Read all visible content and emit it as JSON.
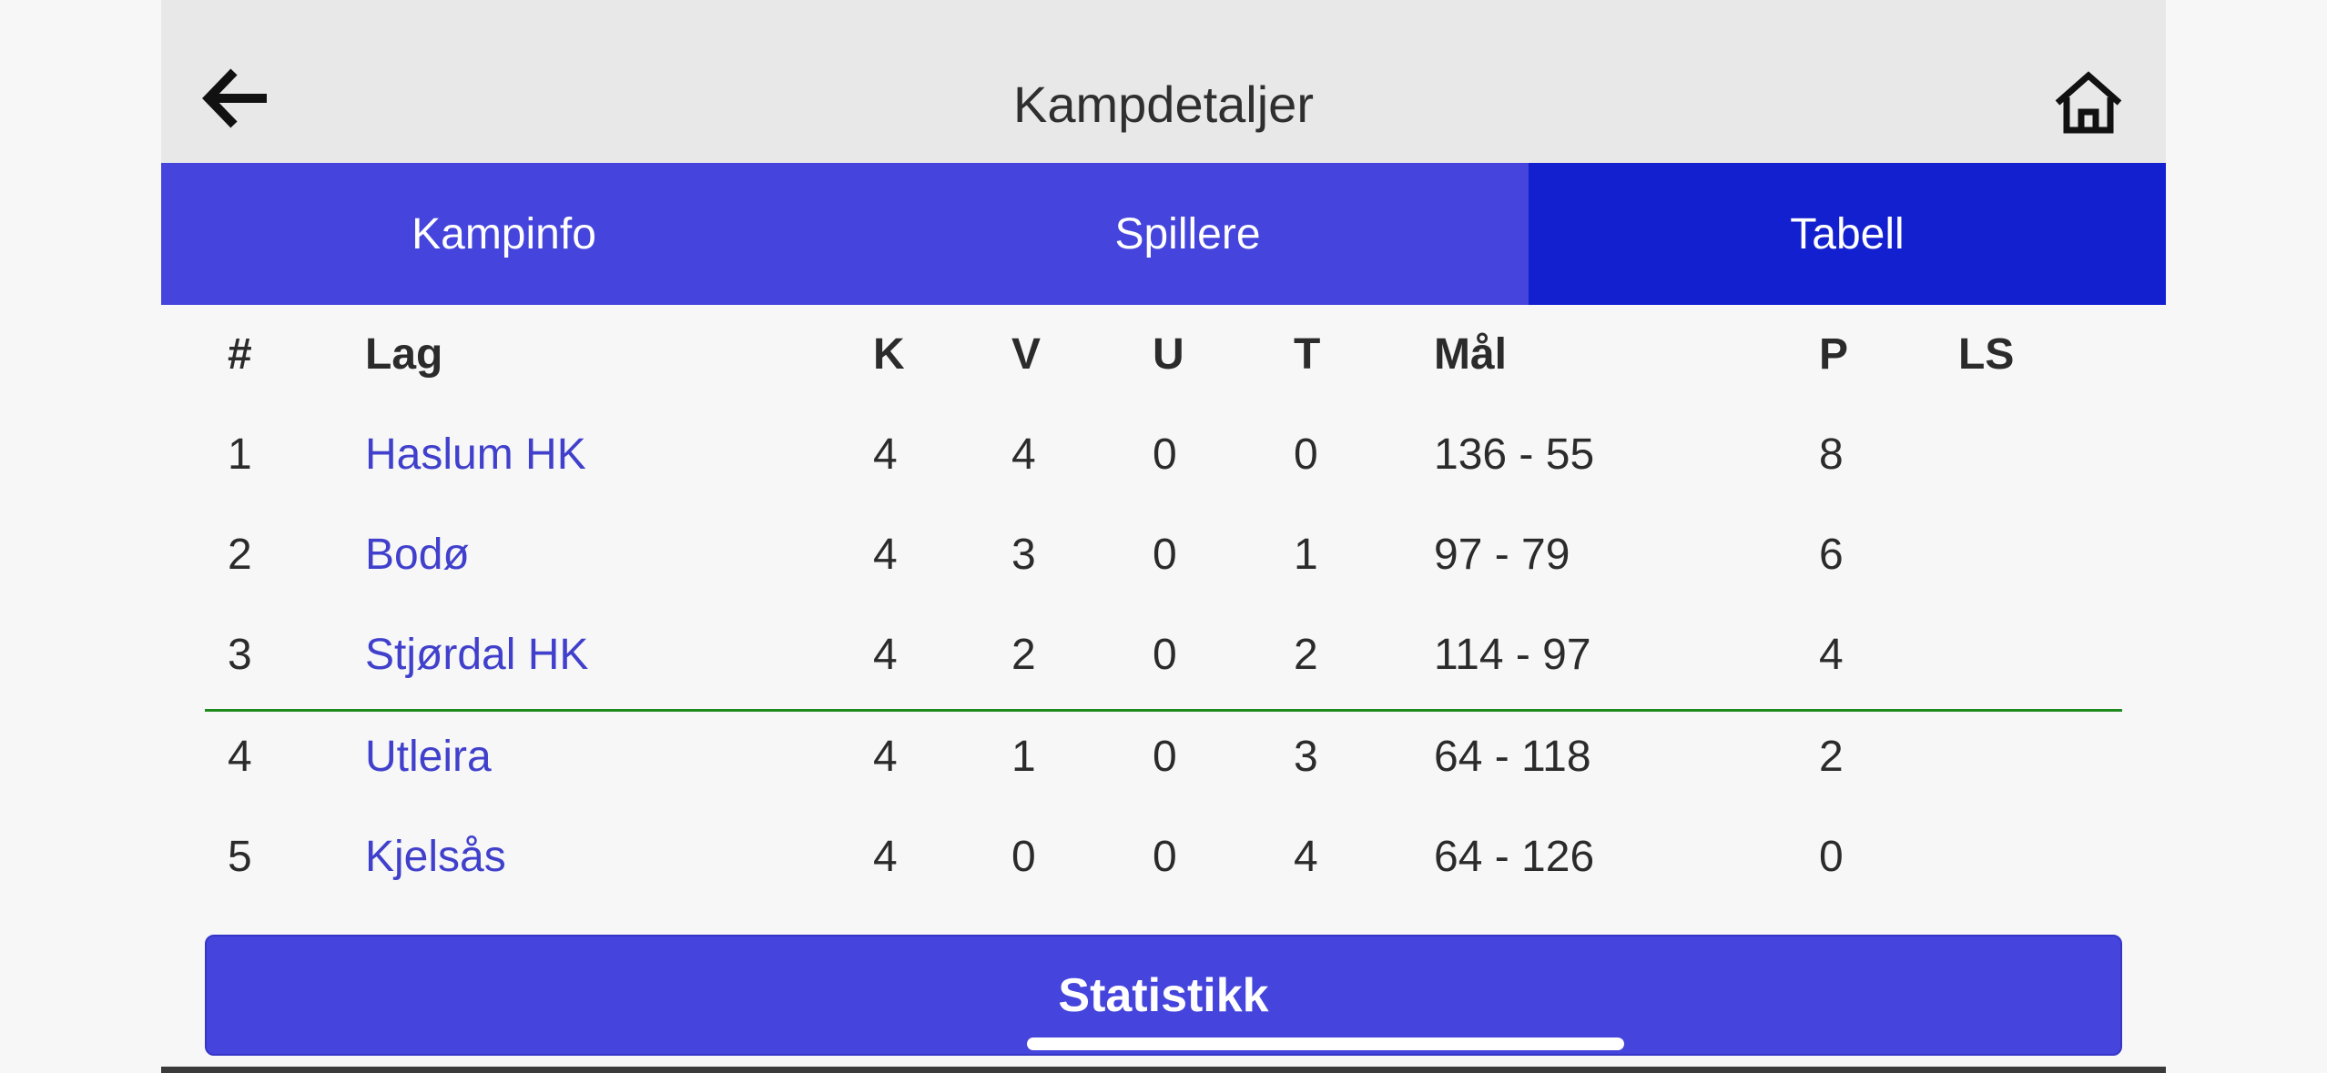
{
  "header": {
    "title": "Kampdetaljer"
  },
  "icons": {
    "back": "arrow-left-icon",
    "home": "home-icon"
  },
  "tabs": [
    {
      "label": "Kampinfo",
      "active": false
    },
    {
      "label": "Spillere",
      "active": false
    },
    {
      "label": "Tabell",
      "active": true
    }
  ],
  "table": {
    "columns": [
      "#",
      "Lag",
      "K",
      "V",
      "U",
      "T",
      "Mål",
      "P",
      "LS"
    ],
    "rows": [
      {
        "pos": "1",
        "lag": "Haslum HK",
        "k": "4",
        "v": "4",
        "u": "0",
        "t": "0",
        "mal": "136 - 55",
        "p": "8",
        "ls": ""
      },
      {
        "pos": "2",
        "lag": "Bodø",
        "k": "4",
        "v": "3",
        "u": "0",
        "t": "1",
        "mal": "97 - 79",
        "p": "6",
        "ls": ""
      },
      {
        "pos": "3",
        "lag": "Stjørdal HK",
        "k": "4",
        "v": "2",
        "u": "0",
        "t": "2",
        "mal": "114 - 97",
        "p": "4",
        "ls": ""
      },
      {
        "pos": "4",
        "lag": "Utleira",
        "k": "4",
        "v": "1",
        "u": "0",
        "t": "3",
        "mal": "64 - 118",
        "p": "2",
        "ls": ""
      },
      {
        "pos": "5",
        "lag": "Kjelsås",
        "k": "4",
        "v": "0",
        "u": "0",
        "t": "4",
        "mal": "64 - 126",
        "p": "0",
        "ls": ""
      }
    ]
  },
  "footer": {
    "stats_label": "Statistikk"
  },
  "colors": {
    "accent": "#4545dd",
    "active_tab": "#1320cf",
    "link": "#4040cc",
    "divider": "#1e8a1e"
  }
}
